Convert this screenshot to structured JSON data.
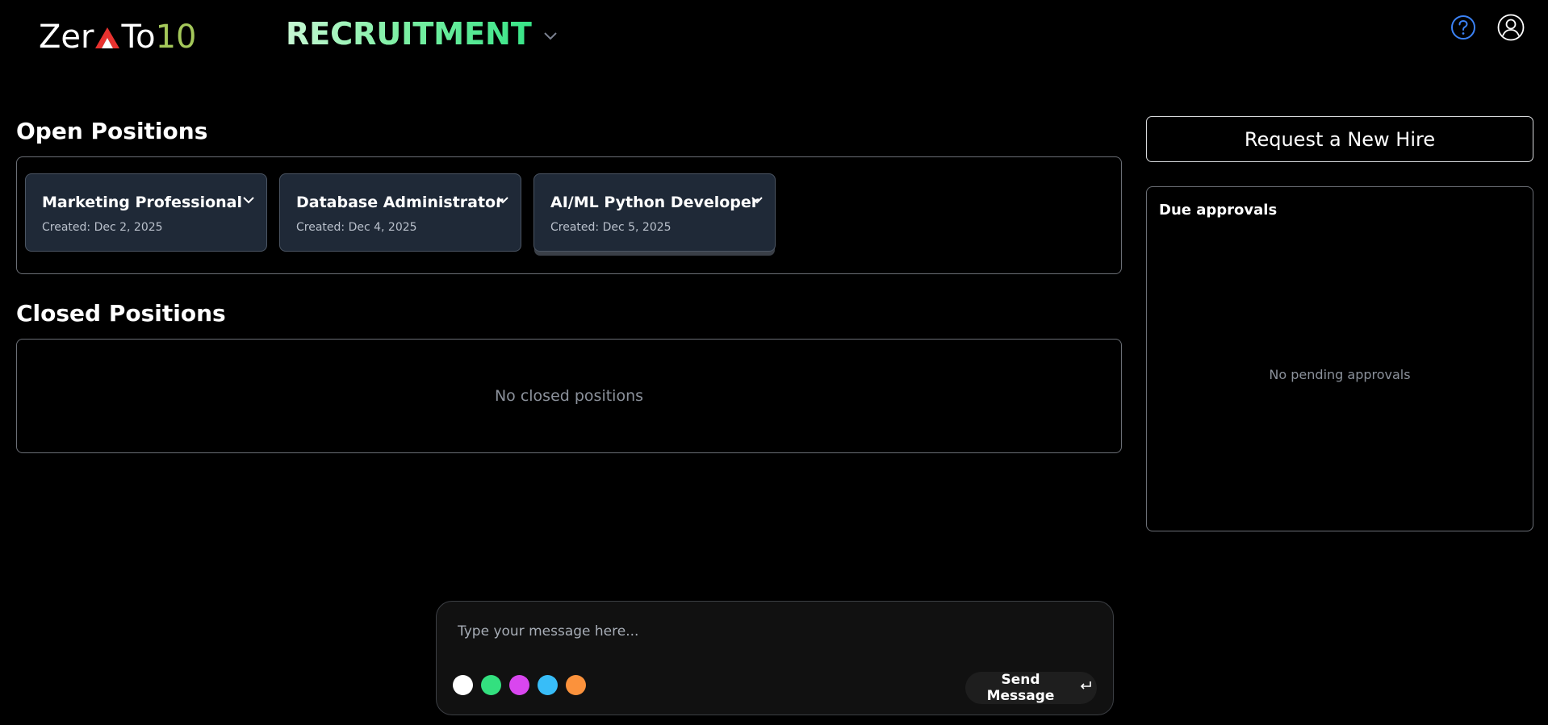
{
  "header": {
    "logo": {
      "part1": "Zer",
      "part2": "To",
      "part3": "10"
    },
    "app_title": "RECRUITMENT"
  },
  "open_positions": {
    "heading": "Open Positions",
    "cards": [
      {
        "title": "Marketing Professional",
        "created": "Created: Dec 2, 2025"
      },
      {
        "title": "Database Administrator",
        "created": "Created: Dec 4, 2025"
      },
      {
        "title": "AI/ML Python Developer",
        "created": "Created: Dec 5, 2025"
      }
    ]
  },
  "closed_positions": {
    "heading": "Closed Positions",
    "empty_text": "No closed positions"
  },
  "sidebar": {
    "request_button": "Request a New Hire",
    "due_approvals_title": "Due approvals",
    "empty_text": "No pending approvals"
  },
  "chat": {
    "placeholder": "Type your message here...",
    "send_label": "Send Message",
    "swatches": [
      "#ffffff",
      "#33e07f",
      "#d946ef",
      "#38bdf8",
      "#fb923c"
    ]
  },
  "colors": {
    "background": "#000000",
    "card_bg": "#1f2937",
    "accent_green": "#3fe08a",
    "logo_green": "#a4c85a",
    "help_blue": "#3b82f6"
  }
}
